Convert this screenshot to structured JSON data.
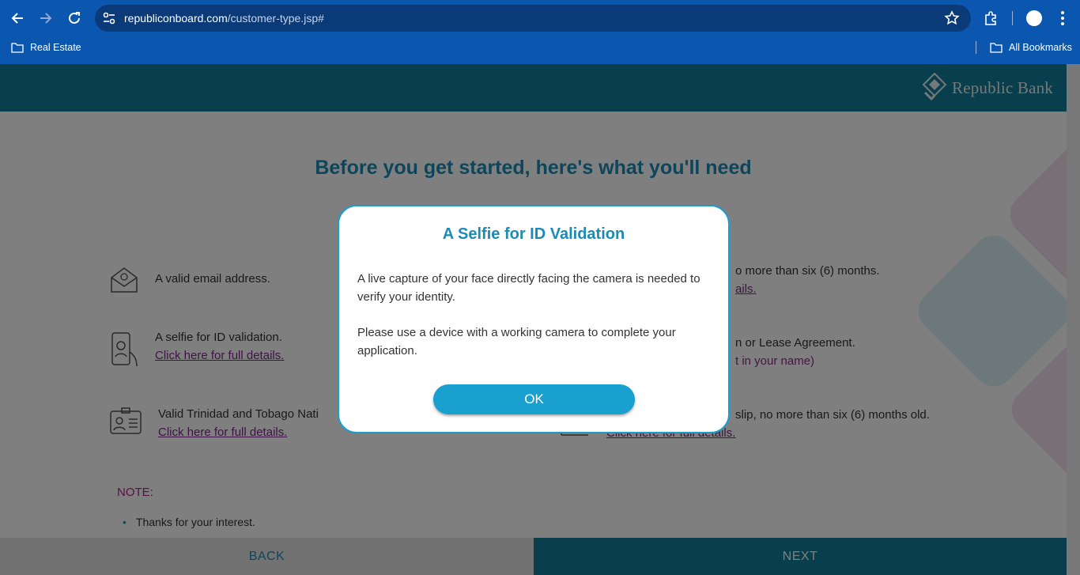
{
  "browser": {
    "url_host": "republiconboard.com",
    "url_path": "/customer-type.jsp#",
    "bookmarks": [
      {
        "label": "Real Estate",
        "icon": "folder-icon"
      },
      {
        "label": "All Bookmarks",
        "icon": "folder-icon"
      }
    ]
  },
  "header": {
    "logo_text": "Republic Bank"
  },
  "page": {
    "headline": "Before you get started, here's what you'll need",
    "requirements_left": [
      {
        "text": "A valid email address.",
        "icon": "email-icon"
      },
      {
        "text": "A selfie for ID validation.",
        "link": "Click here for full details.",
        "icon": "selfie-phone-icon"
      },
      {
        "text": "Valid Trinidad and Tobago Nati",
        "link": "Click here for full details.",
        "icon": "id-card-icon"
      }
    ],
    "requirements_right": [
      {
        "text": "o more than six (6) months.",
        "link": "ails."
      },
      {
        "text": "n or Lease Agreement.",
        "extra": "t in your name)"
      },
      {
        "text": "slip, no more than six (6) months old.",
        "link": "Click here for full details."
      }
    ],
    "note_label": "NOTE:",
    "note_items": [
      "Thanks for your interest."
    ],
    "back_label": "BACK",
    "next_label": "NEXT"
  },
  "modal": {
    "title": "A Selfie for ID Validation",
    "paragraph1": "A live capture of your face directly facing the camera is needed to verify your identity.",
    "paragraph2": "Please use a device with a working camera to complete your application.",
    "ok_label": "OK"
  },
  "colors": {
    "chrome_blue": "#0b57b0",
    "header_teal": "#127f98",
    "headline_blue": "#1a8bb7",
    "link_purple": "#7a2a88",
    "note_magenta": "#b0247e",
    "ok_button": "#1aa0cf"
  }
}
